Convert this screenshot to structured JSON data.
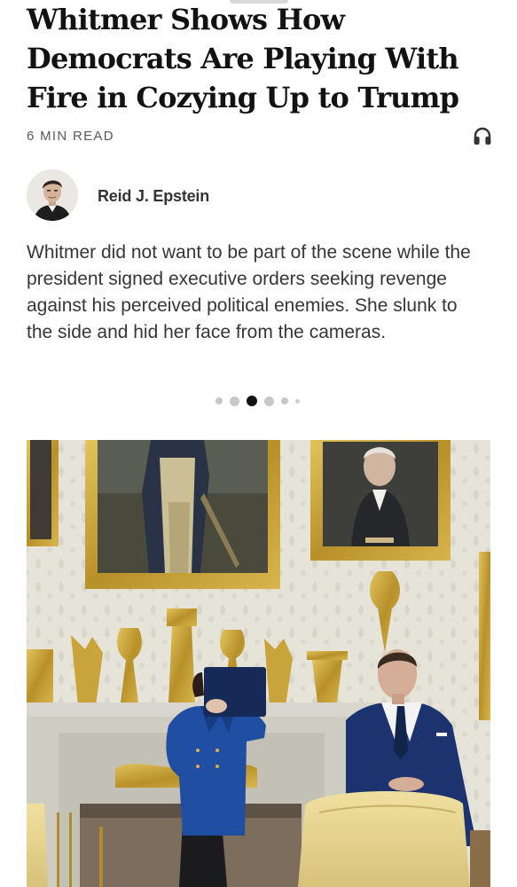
{
  "article": {
    "headline": "Whitmer Shows How Democrats Are Playing With Fire in Cozying Up to Trump",
    "read_time": "6 MIN READ",
    "author": "Reid J. Epstein",
    "summary": "Whitmer did not want to be part of the scene while the president signed executive orders seeking revenge against his perceived political enemies. She slunk to the side and hid her face from the cameras."
  },
  "icons": {
    "listen": "headphones-icon"
  },
  "carousel": {
    "total_dots": 6,
    "active_index": 2
  },
  "colors": {
    "text": "#121212",
    "meta": "#5a5a5a",
    "summary": "#363636",
    "dot_inactive": "#c7c7c7",
    "dot_active": "#121212",
    "blazer_blue": "#1f4ea3",
    "suit_navy": "#1c3370",
    "gold": "#c9a43a"
  }
}
